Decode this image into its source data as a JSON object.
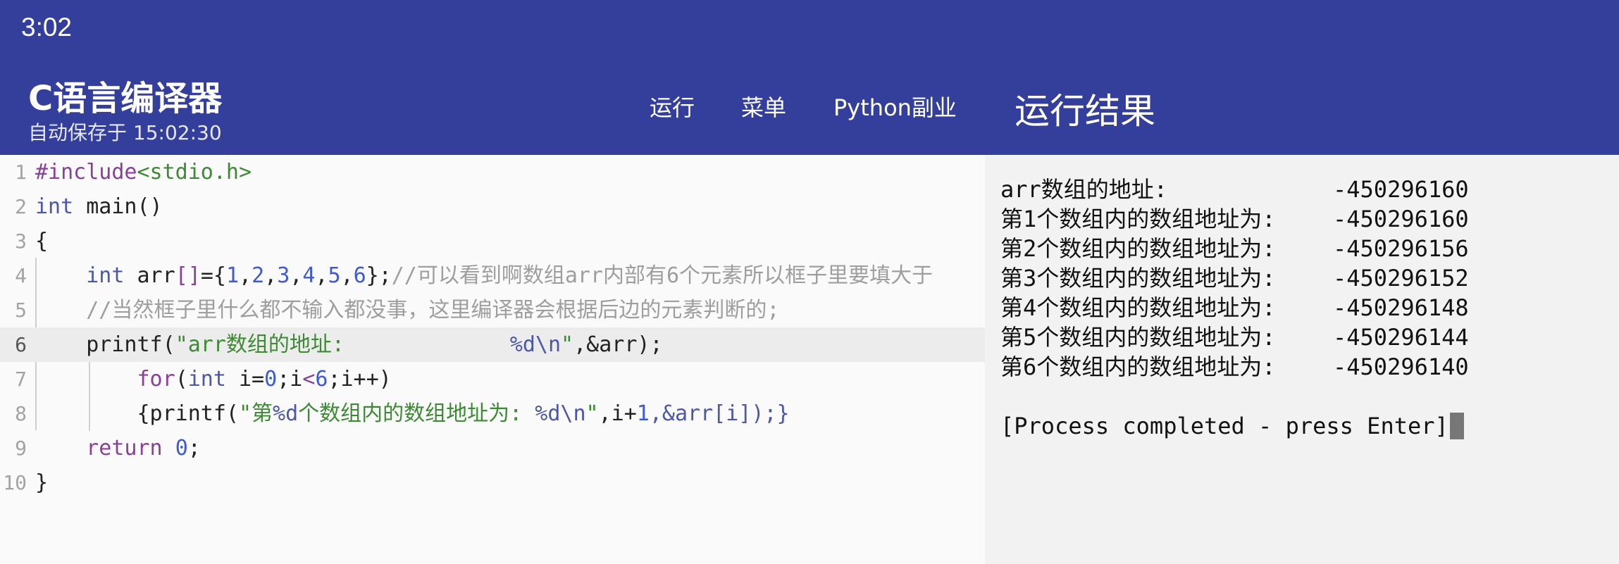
{
  "status_bar": {
    "time": "3:02"
  },
  "app": {
    "title": "C语言编译器",
    "autosave": "自动保存于 15:02:30"
  },
  "nav": {
    "run": "运行",
    "menu": "菜单",
    "python": "Python副业",
    "result": "运行结果"
  },
  "editor": {
    "line_numbers": [
      "1",
      "2",
      "3",
      "4",
      "5",
      "6",
      "7",
      "8",
      "9",
      "10"
    ],
    "lines": [
      [
        {
          "t": "#include",
          "c": "pp"
        },
        {
          "t": "<stdio.h>",
          "c": "str"
        }
      ],
      [
        {
          "t": "int",
          "c": "kw"
        },
        {
          "t": " main()",
          "c": "pl"
        }
      ],
      [
        {
          "t": "{",
          "c": "pl"
        }
      ],
      [
        {
          "t": "    ",
          "c": "pl"
        },
        {
          "t": "int",
          "c": "kw"
        },
        {
          "t": " arr",
          "c": "pl"
        },
        {
          "t": "[]",
          "c": "pp"
        },
        {
          "t": "={",
          "c": "pl"
        },
        {
          "t": "1",
          "c": "num"
        },
        {
          "t": ",",
          "c": "pl"
        },
        {
          "t": "2",
          "c": "num"
        },
        {
          "t": ",",
          "c": "pl"
        },
        {
          "t": "3",
          "c": "num"
        },
        {
          "t": ",",
          "c": "pl"
        },
        {
          "t": "4",
          "c": "num"
        },
        {
          "t": ",",
          "c": "pl"
        },
        {
          "t": "5",
          "c": "num"
        },
        {
          "t": ",",
          "c": "pl"
        },
        {
          "t": "6",
          "c": "num"
        },
        {
          "t": "};",
          "c": "pl"
        },
        {
          "t": "//可以看到啊数组arr内部有6个元素所以框子里要填大于",
          "c": "cm"
        }
      ],
      [
        {
          "t": "    ",
          "c": "pl"
        },
        {
          "t": "//当然框子里什么都不输入都没事，这里编译器会根据后边的元素判断的;",
          "c": "cm"
        }
      ],
      [
        {
          "t": "    printf(",
          "c": "pl"
        },
        {
          "t": "\"arr数组的地址:             ",
          "c": "str"
        },
        {
          "t": "%d",
          "c": "esc"
        },
        {
          "t": "\\n",
          "c": "esc"
        },
        {
          "t": "\"",
          "c": "str"
        },
        {
          "t": ",&arr);",
          "c": "pl"
        }
      ],
      [
        {
          "t": "        ",
          "c": "pl"
        },
        {
          "t": "for",
          "c": "pp"
        },
        {
          "t": "(",
          "c": "pl"
        },
        {
          "t": "int",
          "c": "kw"
        },
        {
          "t": " i=",
          "c": "pl"
        },
        {
          "t": "0",
          "c": "num"
        },
        {
          "t": ";i",
          "c": "pl"
        },
        {
          "t": "<",
          "c": "pp"
        },
        {
          "t": "6",
          "c": "num"
        },
        {
          "t": ";i++)",
          "c": "pl"
        }
      ],
      [
        {
          "t": "        {printf(",
          "c": "pl"
        },
        {
          "t": "\"第",
          "c": "str"
        },
        {
          "t": "%d",
          "c": "esc"
        },
        {
          "t": "个数组内的数组地址为: ",
          "c": "str"
        },
        {
          "t": "%d",
          "c": "esc"
        },
        {
          "t": "\\n",
          "c": "esc"
        },
        {
          "t": "\"",
          "c": "str"
        },
        {
          "t": ",i+",
          "c": "pl"
        },
        {
          "t": "1",
          "c": "num"
        },
        {
          "t": ",&arr[i]);}",
          "c": "kw"
        }
      ],
      [
        {
          "t": "    ",
          "c": "pl"
        },
        {
          "t": "return",
          "c": "pp"
        },
        {
          "t": " ",
          "c": "pl"
        },
        {
          "t": "0",
          "c": "num"
        },
        {
          "t": ";",
          "c": "pl"
        }
      ],
      [
        {
          "t": "}",
          "c": "pl"
        }
      ]
    ]
  },
  "output": {
    "rows": [
      {
        "label": "arr数组的地址:",
        "value": "-450296160"
      },
      {
        "label": "第1个数组内的数组地址为:",
        "value": "-450296160"
      },
      {
        "label": "第2个数组内的数组地址为:",
        "value": "-450296156"
      },
      {
        "label": "第3个数组内的数组地址为:",
        "value": "-450296152"
      },
      {
        "label": "第4个数组内的数组地址为:",
        "value": "-450296148"
      },
      {
        "label": "第5个数组内的数组地址为:",
        "value": "-450296144"
      },
      {
        "label": "第6个数组内的数组地址为:",
        "value": "-450296140"
      }
    ],
    "completion": "[Process completed - press Enter]"
  },
  "colors": {
    "appbar": "#343f9c",
    "output_bg": "#f2f2f2",
    "editor_bg": "#fafafa",
    "keyword": "#4c58a6",
    "preprocessor": "#8a3f9a",
    "string": "#3e8a34",
    "number": "#3e5bd1",
    "comment": "#9e9e9e"
  }
}
